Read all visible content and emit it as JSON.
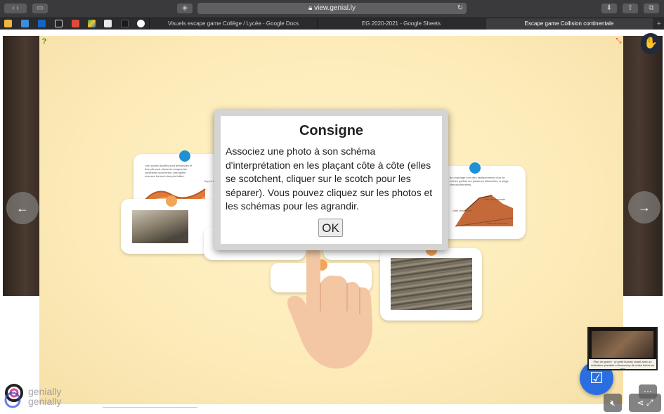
{
  "browser": {
    "url": "view.genial.ly",
    "tabs": [
      {
        "title": "Visuels escape game Collège / Lycée - Google Docs",
        "active": false
      },
      {
        "title": "EG 2020-2021 - Google Sheets",
        "active": false
      },
      {
        "title": "Escape game Collision continentale",
        "active": true
      }
    ],
    "bookmark_icons": [
      "calendar-icon",
      "twitter-icon",
      "outlook-icon",
      "pronote-icon",
      "gmail-icon",
      "drive-icon",
      "notes-icon",
      "dark-app-icon",
      "google-icon"
    ],
    "colors": {
      "chrome": "#3a3a3c",
      "tab_bar": "#2b2b2d"
    }
  },
  "modal": {
    "title": "Consigne",
    "body": "Associez une photo à son schéma d'interprétation en les plaçant côte à côte (elles se scotchent, cliquer sur le scotch pour les séparer). Vous pouvez cliquez sur les photos et les schémas pour les agrandir.",
    "ok_label": "OK"
  },
  "cards": {
    "left_diagram_text": "Les roches ductiles sont déformées et des plis sont observés lorsque les continents sont fortes, des failles inverses forment des plis failles.",
    "left_diagram_label": "Nappe de charriage",
    "right_diagram_text": "de charriage sont des déplacements d'un de roches parfois sur plusieurs kilomètres, à longs chevauchements.",
    "right_diagram_label_1": "Unité chevauchante",
    "right_diagram_label_2": "Unité chevauchée",
    "right_diagram_label_3": "Faille chevauchante"
  },
  "navigation": {
    "prev_symbol": "←",
    "next_symbol": "→"
  },
  "branding": {
    "logo_text": "genially",
    "logo_text_shadow": "genially"
  },
  "thumbnail": {
    "caption": "Plan de guerre : un petit bureau vivant avec un ordinateur portable et beaucoup de notes fixées au mur"
  },
  "icons": {
    "help": "help-icon",
    "fullscreen": "fullscreen-icon",
    "cursor": "hand-pointer-icon",
    "check": "checklist-icon",
    "mute": "mute-icon",
    "share": "share-icon",
    "expand": "expand-icon",
    "more": "more-icon"
  },
  "colors": {
    "paper": "#fdecba",
    "pin_blue": "#1f8fd8",
    "pin_orange": "#f3a457",
    "fab_blue": "#2a6ee0"
  }
}
